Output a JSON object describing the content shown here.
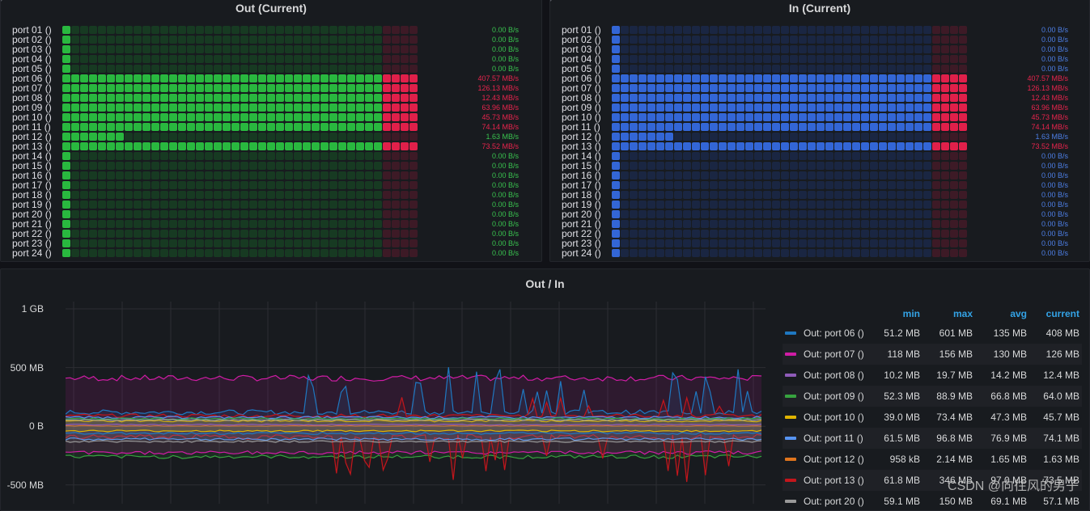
{
  "out_panel": {
    "title": "Out (Current)"
  },
  "in_panel": {
    "title": "In (Current)"
  },
  "ports": [
    {
      "label": "port 01 ()",
      "value": "0.00 B/s",
      "level": 1,
      "status": "ok"
    },
    {
      "label": "port 02 ()",
      "value": "0.00 B/s",
      "level": 1,
      "status": "ok"
    },
    {
      "label": "port 03 ()",
      "value": "0.00 B/s",
      "level": 1,
      "status": "ok"
    },
    {
      "label": "port 04 ()",
      "value": "0.00 B/s",
      "level": 1,
      "status": "ok"
    },
    {
      "label": "port 05 ()",
      "value": "0.00 B/s",
      "level": 1,
      "status": "ok"
    },
    {
      "label": "port 06 ()",
      "value": "407.57 MB/s",
      "level": 40,
      "status": "high"
    },
    {
      "label": "port 07 ()",
      "value": "126.13 MB/s",
      "level": 40,
      "status": "high"
    },
    {
      "label": "port 08 ()",
      "value": "12.43 MB/s",
      "level": 40,
      "status": "high"
    },
    {
      "label": "port 09 ()",
      "value": "63.96 MB/s",
      "level": 40,
      "status": "high"
    },
    {
      "label": "port 10 ()",
      "value": "45.73 MB/s",
      "level": 40,
      "status": "high"
    },
    {
      "label": "port 11 ()",
      "value": "74.14 MB/s",
      "level": 40,
      "status": "high"
    },
    {
      "label": "port 12 ()",
      "value": "1.63 MB/s",
      "level": 7,
      "status": "ok"
    },
    {
      "label": "port 13 ()",
      "value": "73.52 MB/s",
      "level": 40,
      "status": "high"
    },
    {
      "label": "port 14 ()",
      "value": "0.00 B/s",
      "level": 1,
      "status": "ok"
    },
    {
      "label": "port 15 ()",
      "value": "0.00 B/s",
      "level": 1,
      "status": "ok"
    },
    {
      "label": "port 16 ()",
      "value": "0.00 B/s",
      "level": 1,
      "status": "ok"
    },
    {
      "label": "port 17 ()",
      "value": "0.00 B/s",
      "level": 1,
      "status": "ok"
    },
    {
      "label": "port 18 ()",
      "value": "0.00 B/s",
      "level": 1,
      "status": "ok"
    },
    {
      "label": "port 19 ()",
      "value": "0.00 B/s",
      "level": 1,
      "status": "ok"
    },
    {
      "label": "port 20 ()",
      "value": "0.00 B/s",
      "level": 1,
      "status": "ok"
    },
    {
      "label": "port 21 ()",
      "value": "0.00 B/s",
      "level": 1,
      "status": "ok"
    },
    {
      "label": "port 22 ()",
      "value": "0.00 B/s",
      "level": 1,
      "status": "ok"
    },
    {
      "label": "port 23 ()",
      "value": "0.00 B/s",
      "level": 1,
      "status": "ok"
    },
    {
      "label": "port 24 ()",
      "value": "0.00 B/s",
      "level": 1,
      "status": "ok"
    }
  ],
  "gauge": {
    "total_cells": 40,
    "threshold_cell": 36
  },
  "colors": {
    "out_on": "#29b83f",
    "out_off": "#173a22",
    "in_on": "#3366d6",
    "in_off": "#1a2642",
    "alert_on": "#e0204a",
    "alert_off": "#3d1a26",
    "ok_text_out": "#39c34f",
    "ok_text_in": "#4d7fe6",
    "alert_text": "#e8244d"
  },
  "chart_panel": {
    "title": "Out / In"
  },
  "chart_data": {
    "type": "line",
    "title": "Out / In",
    "y_ticks": [
      "1 GB",
      "500 MB",
      "0 B",
      "-500 MB"
    ],
    "ylim_mb": [
      -560,
      1000
    ],
    "grid": true,
    "legend_placement": "right",
    "legend_columns": [
      "min",
      "max",
      "avg",
      "current"
    ],
    "series": [
      {
        "name": "Out: port 06 ()",
        "color": "#1f78c1",
        "min": "51.2 MB",
        "max": "601 MB",
        "avg": "135 MB",
        "current": "408 MB"
      },
      {
        "name": "Out: port 07 ()",
        "color": "#d01ca5",
        "min": "118 MB",
        "max": "156 MB",
        "avg": "130 MB",
        "current": "126 MB"
      },
      {
        "name": "Out: port 08 ()",
        "color": "#8f5bb9",
        "min": "10.2 MB",
        "max": "19.7 MB",
        "avg": "14.2 MB",
        "current": "12.4 MB"
      },
      {
        "name": "Out: port 09 ()",
        "color": "#37a33f",
        "min": "52.3 MB",
        "max": "88.9 MB",
        "avg": "66.8 MB",
        "current": "64.0 MB"
      },
      {
        "name": "Out: port 10 ()",
        "color": "#e0b400",
        "min": "39.0 MB",
        "max": "73.4 MB",
        "avg": "47.3 MB",
        "current": "45.7 MB"
      },
      {
        "name": "Out: port 11 ()",
        "color": "#5794f2",
        "min": "61.5 MB",
        "max": "96.8 MB",
        "avg": "76.9 MB",
        "current": "74.1 MB"
      },
      {
        "name": "Out: port 12 ()",
        "color": "#e0751d",
        "min": "958 kB",
        "max": "2.14 MB",
        "avg": "1.65 MB",
        "current": "1.63 MB"
      },
      {
        "name": "Out: port 13 ()",
        "color": "#c4161c",
        "min": "61.8 MB",
        "max": "346 MB",
        "avg": "97.0 MB",
        "current": "73.5 MB"
      },
      {
        "name": "Out: port 20 ()",
        "color": "#999999",
        "min": "59.1 MB",
        "max": "150 MB",
        "avg": "69.1 MB",
        "current": "57.1 MB"
      }
    ]
  },
  "watermark": "CSDN @向往风的男子"
}
